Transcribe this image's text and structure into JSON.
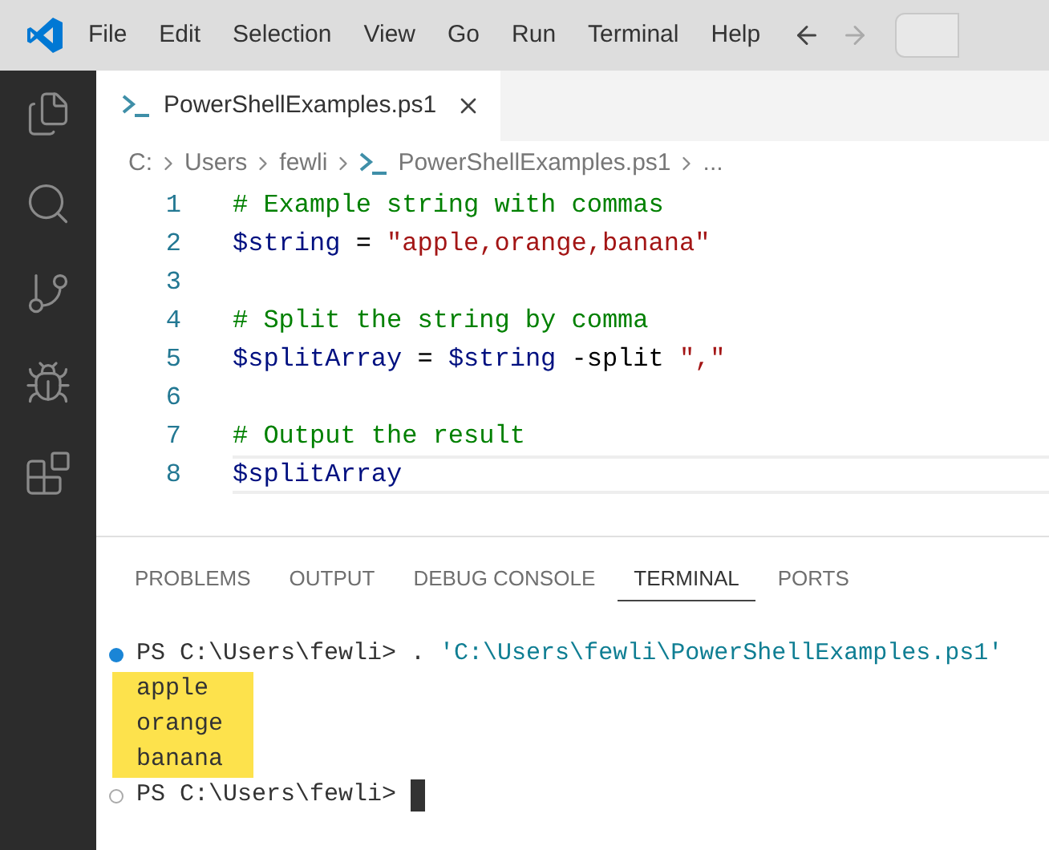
{
  "menu_bar": {
    "items": [
      "File",
      "Edit",
      "Selection",
      "View",
      "Go",
      "Run",
      "Terminal",
      "Help"
    ]
  },
  "editor_tabs": [
    {
      "label": "PowerShellExamples.ps1",
      "selected": true
    }
  ],
  "breadcrumb": [
    "C:",
    "Users",
    "fewli",
    "PowerShellExamples.ps1",
    "..."
  ],
  "code_lines": [
    {
      "number": "1",
      "current": false,
      "tokens": [
        {
          "kind": "comment",
          "text": "# Example string with commas"
        }
      ]
    },
    {
      "number": "2",
      "current": false,
      "tokens": [
        {
          "kind": "variable",
          "text": "$string"
        },
        {
          "kind": "plain",
          "text": " = "
        },
        {
          "kind": "string",
          "text": "\"apple,orange,banana\""
        }
      ]
    },
    {
      "number": "3",
      "current": false
    },
    {
      "number": "4",
      "current": false,
      "tokens": [
        {
          "kind": "comment",
          "text": "# Split the string by comma"
        }
      ]
    },
    {
      "number": "5",
      "current": false,
      "tokens": [
        {
          "kind": "variable",
          "text": "$splitArray"
        },
        {
          "kind": "plain",
          "text": " = "
        },
        {
          "kind": "variable",
          "text": "$string"
        },
        {
          "kind": "plain",
          "text": " -split "
        },
        {
          "kind": "string",
          "text": "\",\""
        }
      ]
    },
    {
      "number": "6",
      "current": false
    },
    {
      "number": "7",
      "current": false,
      "tokens": [
        {
          "kind": "comment",
          "text": "# Output the result"
        }
      ]
    },
    {
      "number": "8",
      "current": true,
      "tokens": [
        {
          "kind": "variable",
          "text": "$splitArray"
        }
      ]
    }
  ],
  "panel_tabs": [
    {
      "label": "PROBLEMS",
      "selected": false
    },
    {
      "label": "OUTPUT",
      "selected": false
    },
    {
      "label": "DEBUG CONSOLE",
      "selected": false
    },
    {
      "label": "TERMINAL",
      "selected": true
    },
    {
      "label": "PORTS",
      "selected": false
    }
  ],
  "terminal_lines": [
    {
      "kind": "prompt",
      "succeeded": true,
      "prompt": "PS C:\\Users\\fewli> ",
      "command": ". ",
      "argument": "'C:\\Users\\fewli\\PowerShellExamples.ps1'",
      "cursor": false
    },
    {
      "kind": "output",
      "text": "apple",
      "highlighted": true
    },
    {
      "kind": "output",
      "text": "orange",
      "highlighted": true
    },
    {
      "kind": "output",
      "text": "banana",
      "highlighted": true
    },
    {
      "kind": "prompt",
      "succeeded": false,
      "prompt": "PS C:\\Users\\fewli> ",
      "cursor": true
    }
  ]
}
